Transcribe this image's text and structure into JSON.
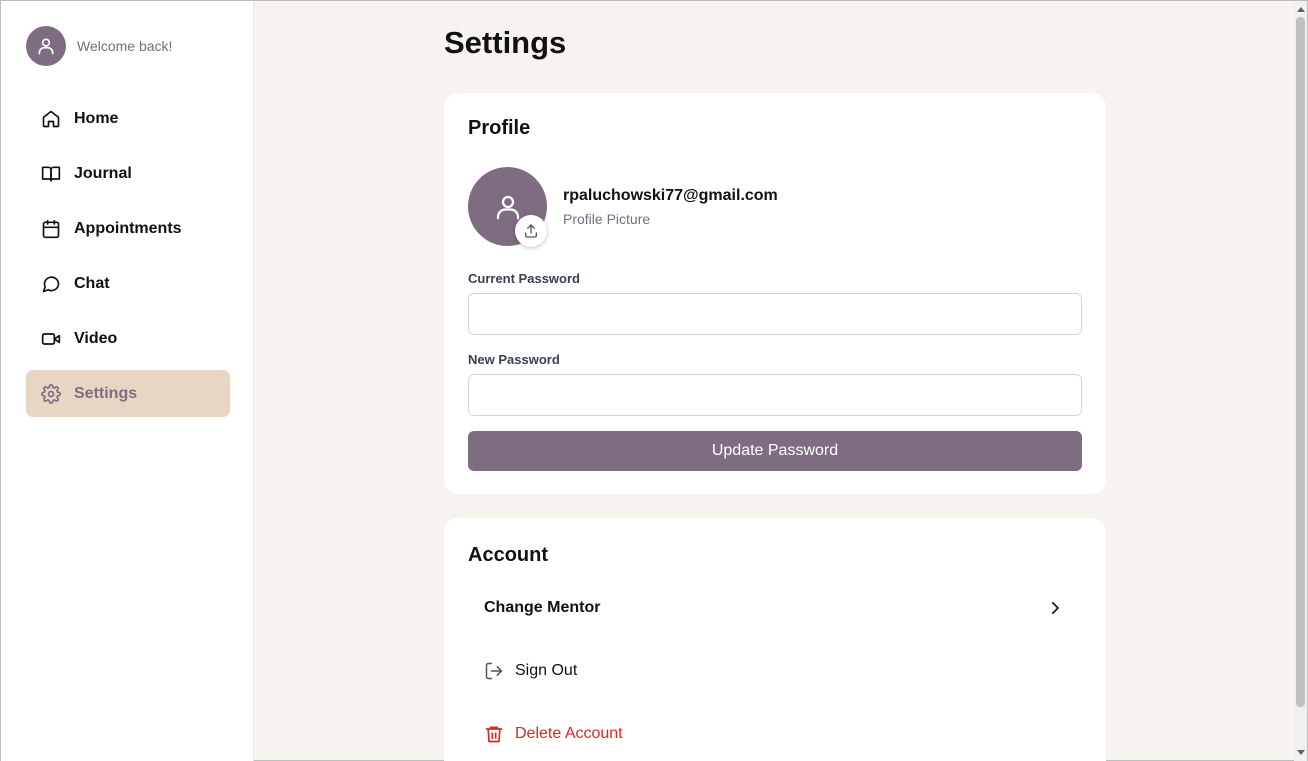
{
  "sidebar": {
    "welcome_text": "Welcome back!",
    "items": [
      {
        "label": "Home",
        "icon": "home-icon",
        "active": false
      },
      {
        "label": "Journal",
        "icon": "book-icon",
        "active": false
      },
      {
        "label": "Appointments",
        "icon": "calendar-icon",
        "active": false
      },
      {
        "label": "Chat",
        "icon": "chat-bubble-icon",
        "active": false
      },
      {
        "label": "Video",
        "icon": "video-camera-icon",
        "active": false
      },
      {
        "label": "Settings",
        "icon": "gear-icon",
        "active": true
      }
    ]
  },
  "page": {
    "title": "Settings"
  },
  "profile": {
    "title": "Profile",
    "email": "rpaluchowski77@gmail.com",
    "picture_caption": "Profile Picture",
    "current_password_label": "Current Password",
    "current_password_value": "",
    "new_password_label": "New Password",
    "new_password_value": "",
    "update_button": "Update Password"
  },
  "account": {
    "title": "Account",
    "change_mentor": "Change Mentor",
    "sign_out": "Sign Out",
    "delete_account": "Delete Account"
  },
  "colors": {
    "accent": "#7e6d81",
    "active_nav_bg": "#e8d5c4",
    "page_bg": "#f7f3ee",
    "danger": "#dc2626"
  }
}
